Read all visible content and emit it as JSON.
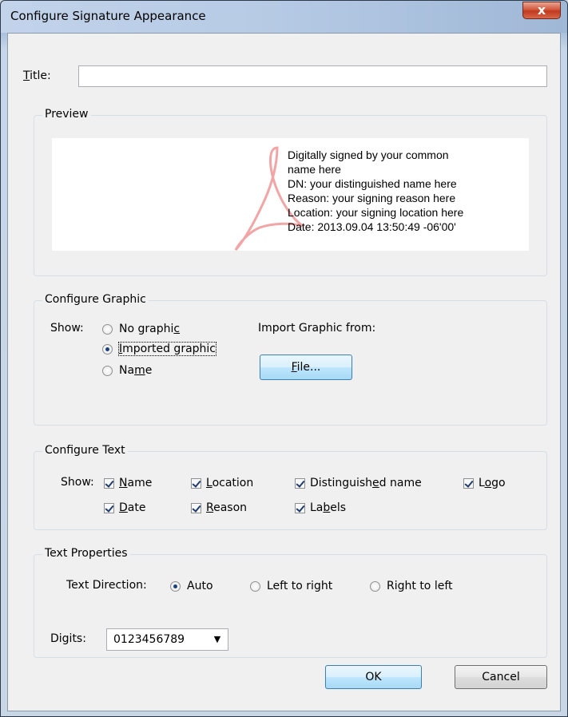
{
  "window": {
    "title": "Configure Signature Appearance",
    "close_glyph": "x"
  },
  "title_field": {
    "label": "Title:",
    "value": ""
  },
  "preview": {
    "label": "Preview",
    "lines": [
      "Digitally signed by your common",
      "name here",
      "DN: your distinguished name here",
      "Reason: your signing reason here",
      "Location: your signing location here",
      "Date: 2013.09.04 13:50:49 -06'00'"
    ],
    "logo_icon": "acrobat-logo-icon",
    "logo_color": "#f2a5a5"
  },
  "configure_graphic": {
    "label": "Configure Graphic",
    "show_label": "Show:",
    "options": [
      "No graphic",
      "Imported graphic",
      "Name"
    ],
    "selected": "Imported graphic",
    "import_label": "Import Graphic from:",
    "file_button": "File..."
  },
  "configure_text": {
    "label": "Configure Text",
    "show_label": "Show:",
    "checkboxes": [
      {
        "label": "Name",
        "checked": true
      },
      {
        "label": "Location",
        "checked": true
      },
      {
        "label": "Distinguished name",
        "checked": true
      },
      {
        "label": "Logo",
        "checked": true
      },
      {
        "label": "Date",
        "checked": true
      },
      {
        "label": "Reason",
        "checked": true
      },
      {
        "label": "Labels",
        "checked": true
      }
    ]
  },
  "text_properties": {
    "label": "Text Properties",
    "direction_label": "Text Direction:",
    "directions": [
      "Auto",
      "Left to right",
      "Right to left"
    ],
    "selected_direction": "Auto",
    "digits_label": "Digits:",
    "digits_value": "0123456789"
  },
  "buttons": {
    "ok": "OK",
    "cancel": "Cancel"
  },
  "colors": {
    "focus_border": "#3c7fb1",
    "close_red": "#c0391f"
  }
}
